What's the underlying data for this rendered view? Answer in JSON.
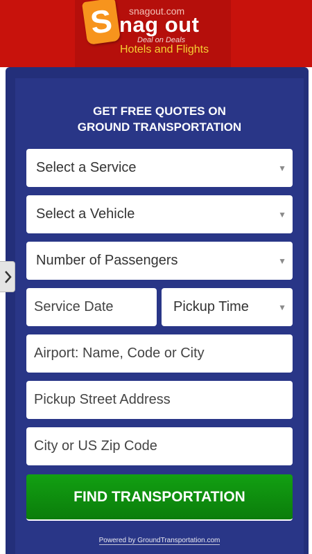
{
  "header": {
    "site": "snagout.com",
    "logo_letter": "S",
    "logo_name": "nag out",
    "slogan": "Deal on Deals",
    "subtitle": "Hotels and Flights"
  },
  "form": {
    "heading_line1": "GET FREE QUOTES ON",
    "heading_line2": "GROUND TRANSPORTATION",
    "service": "Select a Service",
    "vehicle": "Select a Vehicle",
    "passengers": "Number of Passengers",
    "service_date": "Service Date",
    "pickup_time": "Pickup Time",
    "airport": "Airport: Name, Code or City",
    "pickup_address": "Pickup Street Address",
    "city_zip": "City or US Zip Code",
    "submit": "FIND TRANSPORTATION",
    "powered_by": "Powered by GroundTransportation.com"
  },
  "icons": {
    "dropdown": "triangle-down-icon",
    "side_tab": "chevron-right-icon"
  },
  "colors": {
    "header_red": "#c8120c",
    "panel_blue": "#293687",
    "button_green": "#0f910f",
    "logo_orange": "#f7941d",
    "subtitle_yellow": "#f5d033"
  }
}
